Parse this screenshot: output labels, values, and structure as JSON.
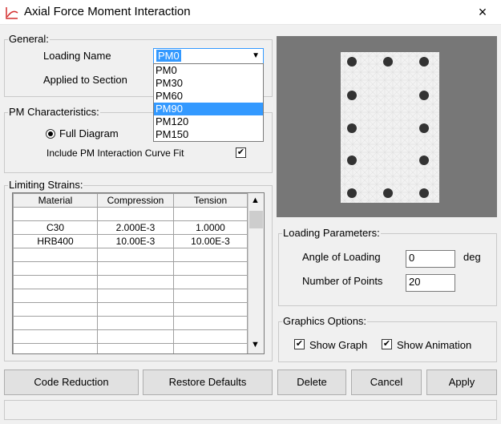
{
  "window": {
    "title": "Axial Force Moment Interaction",
    "close": "×"
  },
  "general": {
    "group_label": "General:",
    "loading_name_label": "Loading Name",
    "loading_name_value": "PM0",
    "applied_to_section_label": "Applied to Section",
    "dropdown_options": [
      "PM0",
      "PM30",
      "PM60",
      "PM90",
      "PM120",
      "PM150"
    ],
    "dropdown_highlighted": "PM90"
  },
  "pm": {
    "group_label": "PM Characteristics:",
    "full_diagram_label": "Full Diagram",
    "curve_fit_label": "Include PM Interaction Curve Fit",
    "curve_fit_checked": true
  },
  "strains": {
    "group_label": "Limiting Strains:",
    "headers": [
      "Material",
      "Compression",
      "Tension"
    ],
    "rows": [
      [
        "C30",
        "2.000E-3",
        "1.0000"
      ],
      [
        "HRB400",
        "10.00E-3",
        "10.00E-3"
      ]
    ]
  },
  "loading_params": {
    "group_label": "Loading Parameters:",
    "angle_label": "Angle of Loading",
    "angle_value": "0",
    "angle_unit": "deg",
    "points_label": "Number of Points",
    "points_value": "20"
  },
  "graphics": {
    "group_label": "Graphics Options:",
    "show_graph_label": "Show Graph",
    "show_animation_label": "Show Animation"
  },
  "buttons": {
    "code_reduction": "Code Reduction",
    "restore_defaults": "Restore Defaults",
    "delete": "Delete",
    "cancel": "Cancel",
    "apply": "Apply"
  }
}
